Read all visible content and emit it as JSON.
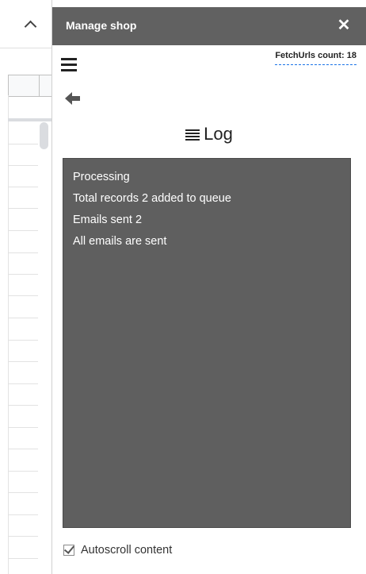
{
  "panel": {
    "title": "Manage shop",
    "close_icon": "close-icon",
    "menu_icon": "hamburger-menu-icon",
    "back_icon": "back-arrow-icon",
    "header_color": "#616161"
  },
  "fetch_urls": {
    "label": "FetchUrls count: 18"
  },
  "log": {
    "heading": "Log",
    "icon": "log-list-icon",
    "background_color": "#5f5f5f",
    "lines": [
      "Processing",
      "Total records 2 added to queue",
      "Emails sent 2",
      "All emails are sent"
    ]
  },
  "autoscroll": {
    "label": "Autoscroll content",
    "checked": true
  },
  "spreadsheet": {
    "collapse_icon": "chevron-up-icon"
  }
}
